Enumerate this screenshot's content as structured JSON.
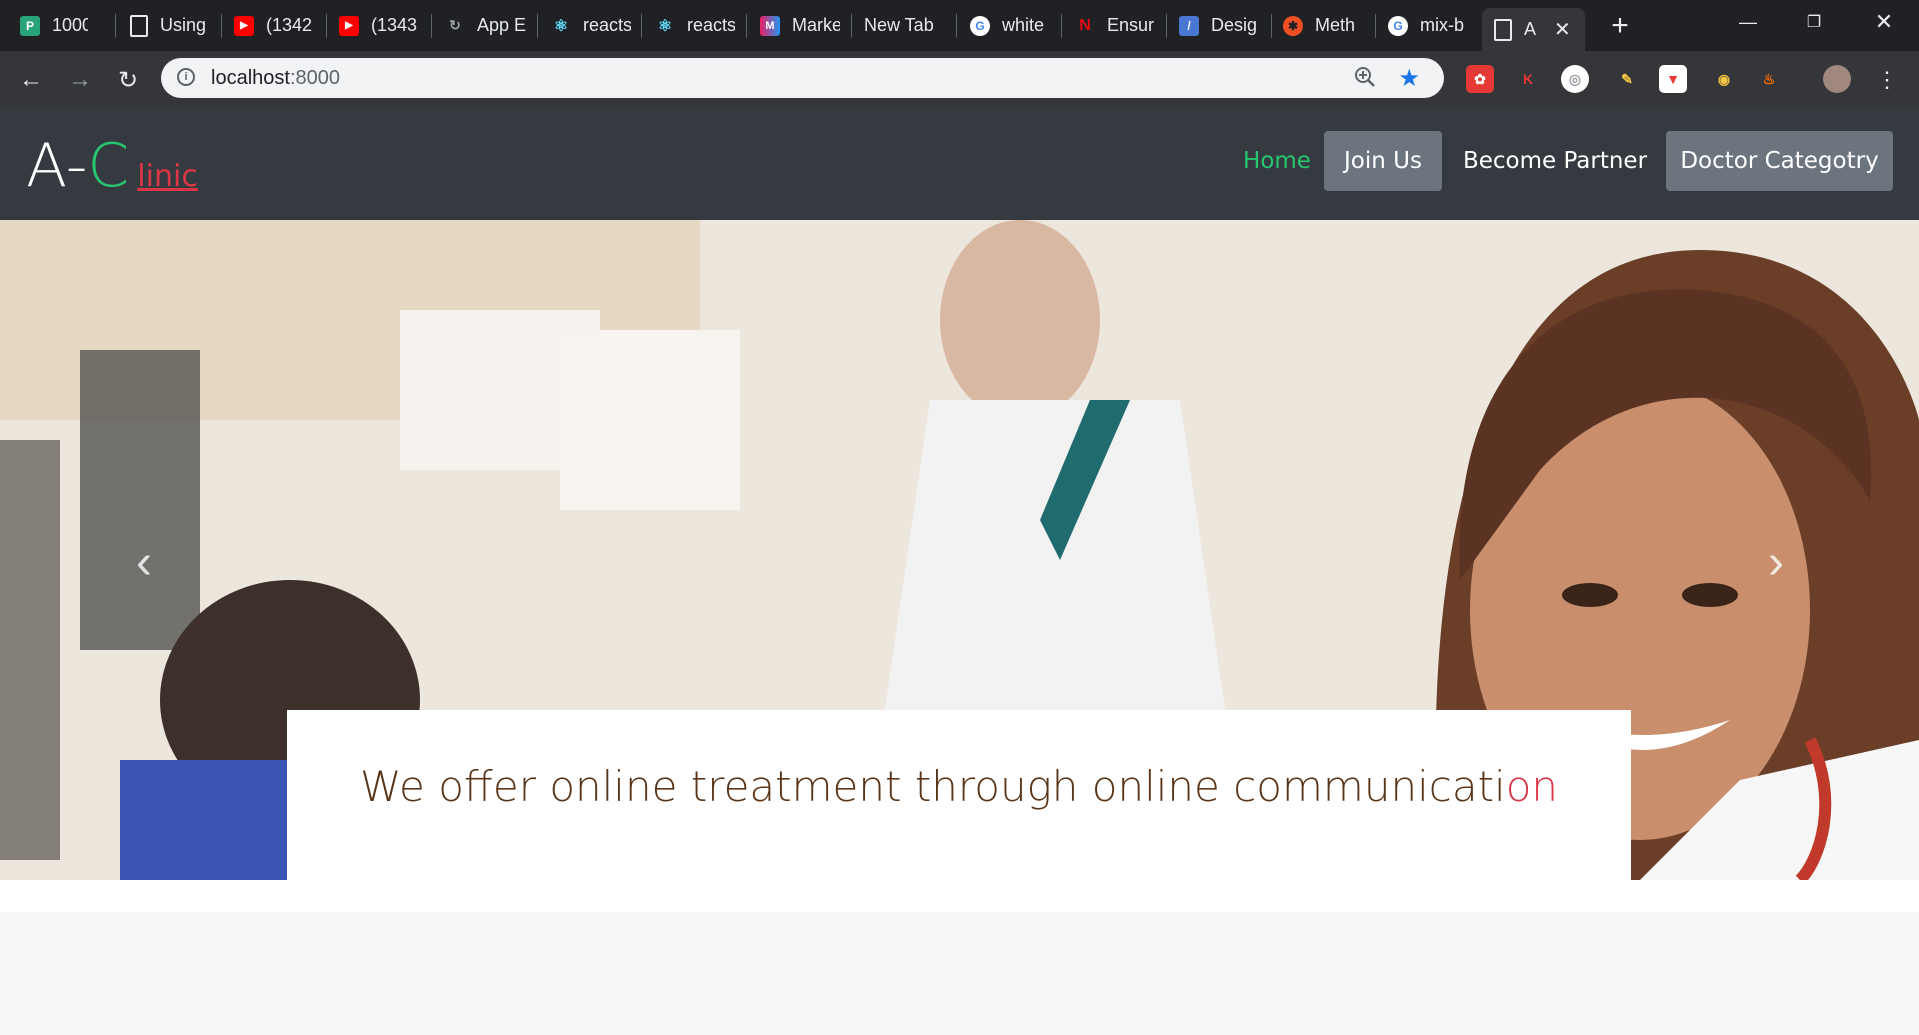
{
  "browser": {
    "tabs": [
      {
        "label": "1000",
        "icon": "bookmark-green-icon",
        "color": "#29a37a"
      },
      {
        "label": "Using",
        "icon": "document-icon",
        "color": "#e8eaed"
      },
      {
        "label": "(1342",
        "icon": "youtube-icon",
        "color": "#ff0000"
      },
      {
        "label": "(1343",
        "icon": "youtube-icon",
        "color": "#ff0000"
      },
      {
        "label": "App E",
        "icon": "app-icon",
        "color": "#202124"
      },
      {
        "label": "reacts",
        "icon": "react-icon",
        "color": "#61dafb"
      },
      {
        "label": "reacts",
        "icon": "react-icon",
        "color": "#61dafb"
      },
      {
        "label": "Marke",
        "icon": "market-icon",
        "color": "#e91e63"
      },
      {
        "label": "New Tab",
        "icon": "",
        "color": ""
      },
      {
        "label": "white",
        "icon": "google-icon",
        "color": "#4285f4"
      },
      {
        "label": "Ensur",
        "icon": "netflix-icon",
        "color": "#e50914"
      },
      {
        "label": "Desig",
        "icon": "design-icon",
        "color": "#4a76d4"
      },
      {
        "label": "Meth",
        "icon": "method-icon",
        "color": "#f04e23"
      },
      {
        "label": "mix-b",
        "icon": "google-icon",
        "color": "#4285f4"
      },
      {
        "label": "A",
        "icon": "document-icon",
        "color": "#e8eaed",
        "active": true
      }
    ],
    "new_tab": "+",
    "url_host": "localhost",
    "url_port": ":8000"
  },
  "navbar": {
    "brand_a": "A-",
    "brand_c": "C",
    "brand_linic": "linic",
    "home": "Home",
    "join": "Join Us",
    "partner": "Become Partner",
    "doctor": "Doctor Categotry"
  },
  "hero": {
    "prev": "‹",
    "next": "›",
    "caption_main": "We offer online treatment through online communicati",
    "caption_red": "on"
  }
}
